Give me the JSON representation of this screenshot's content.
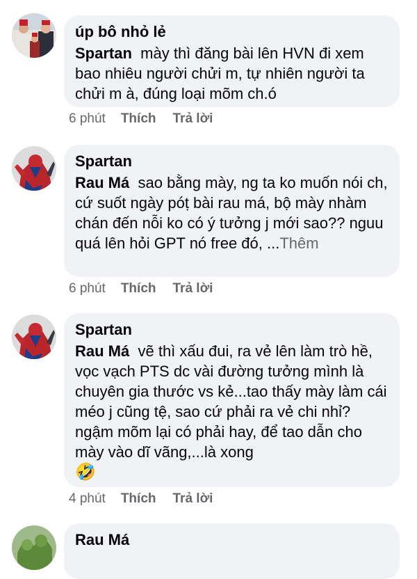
{
  "comments": [
    {
      "author": "úp bô nhỏ lẻ",
      "mention": "Spartan",
      "text": "mày thì đăng bài lên HVN đi xem bao nhiêu người chửi m, tự nhiên người ta chửi m à, đúng loại mõm ch.ó",
      "time": "6 phút",
      "like": "Thích",
      "reply": "Trả lời",
      "avatar_icon": "group-photo-red-hats"
    },
    {
      "author": "Spartan",
      "mention": "Rau Má",
      "text": "sao bằng mày, ng ta ko muốn nói ch, cứ suốt ngày póṭ bài rau má, bộ mày nhàm chán đến nỗi ko có ý tưởng j mới sao?? nguu quá lên hỏi GPT nó free đó, ...",
      "more": "Thêm",
      "time": "6 phút",
      "like": "Thích",
      "reply": "Trả lời",
      "avatar_icon": "spiderman-avatar"
    },
    {
      "author": "Spartan",
      "mention": "Rau Má",
      "text": "vẽ thì xấu đui, ra vẻ lên làm trò hề, vọc vạch PTS dc vài đường tưởng mình là chuyên gia thước vs kẻ...tao thấy mày làm cái méo j cũng tệ, sao cứ phải ra vẻ chi nhỉ? ngậm mõm lại có phải hay, để tao dẫn cho mày vào dĩ vãng,...là xong",
      "emoji": "🤣",
      "time": "4 phút",
      "like": "Thích",
      "reply": "Trả lời",
      "avatar_icon": "spiderman-avatar"
    },
    {
      "author": "Rau Má",
      "avatar_icon": "green-plant-avatar"
    }
  ]
}
